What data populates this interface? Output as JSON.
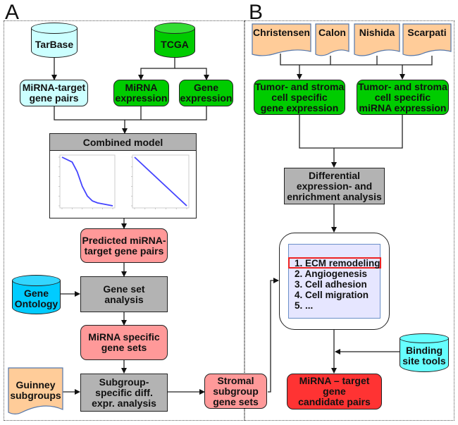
{
  "panels": {
    "a_label": "A",
    "b_label": "B"
  },
  "panel_a": {
    "tarbase": "TarBase",
    "tcga": "TCGA",
    "mirna_target_gene_pairs": "MiRNA-target\ngene pairs",
    "mirna_expression": "MiRNA\nexpression",
    "gene_expression": "Gene\nexpression",
    "combined_model": "Combined model",
    "predicted_pairs": "Predicted miRNA-\ntarget gene pairs",
    "gene_ontology": "Gene\nOntology",
    "gene_set_analysis": "Gene set\nanalysis",
    "mirna_specific_gene_sets": "MiRNA specific\ngene sets",
    "guinney_subgroups": "Guinney\nsubgroups",
    "subgroup_analysis": "Subgroup-\nspecific diff.\nexpr. analysis",
    "stromal_gene_sets": "Stromal\nsubgroup\ngene sets"
  },
  "panel_b": {
    "sources": [
      "Christensen",
      "Calon",
      "Nishida",
      "Scarpati"
    ],
    "tumor_gene_expression": "Tumor- and stroma\ncell specific\ngene expression",
    "tumor_mirna_expression": "Tumor- and stroma\ncell specific\nmiRNA expression",
    "differential_analysis": "Differential\nexpression- and\nenrichment analysis",
    "enrichment_list": [
      "1. ECM remodeling",
      "2. Angiogenesis",
      "3. Cell adhesion",
      "4. Cell migration",
      "5. ..."
    ],
    "highlighted_item": "1. ECM remodeling",
    "binding_site_tools": "Binding\nsite tools",
    "candidate_pairs": "MiRNA – target gene\ncandidate pairs"
  },
  "colors": {
    "green": "#00cc00",
    "light_cyan": "#ccffff",
    "cyan": "#00ccff",
    "pink": "#ff9999",
    "red": "#ff3333",
    "gray": "#b3b3b3",
    "document_orange": "#ffcc99",
    "list_bg": "#e6e6ff",
    "highlight": "#ee2222",
    "line_blue": "#4444ff"
  },
  "chart_data": [
    {
      "type": "line",
      "title": "",
      "x": [
        0,
        1,
        1.5,
        2,
        2.5,
        3,
        3.5,
        4,
        5
      ],
      "y": [
        5,
        4.5,
        3.5,
        2,
        1,
        0.5,
        0.3,
        0.2,
        0
      ],
      "xlabel": "",
      "ylabel": "",
      "xlim": [
        0,
        5
      ],
      "ylim": [
        0,
        5
      ],
      "grid": false
    },
    {
      "type": "line",
      "title": "",
      "x": [
        1,
        5
      ],
      "y": [
        5,
        1
      ],
      "xlabel": "",
      "ylabel": "",
      "xlim": [
        1,
        5
      ],
      "ylim": [
        1,
        5
      ],
      "grid": false
    }
  ]
}
